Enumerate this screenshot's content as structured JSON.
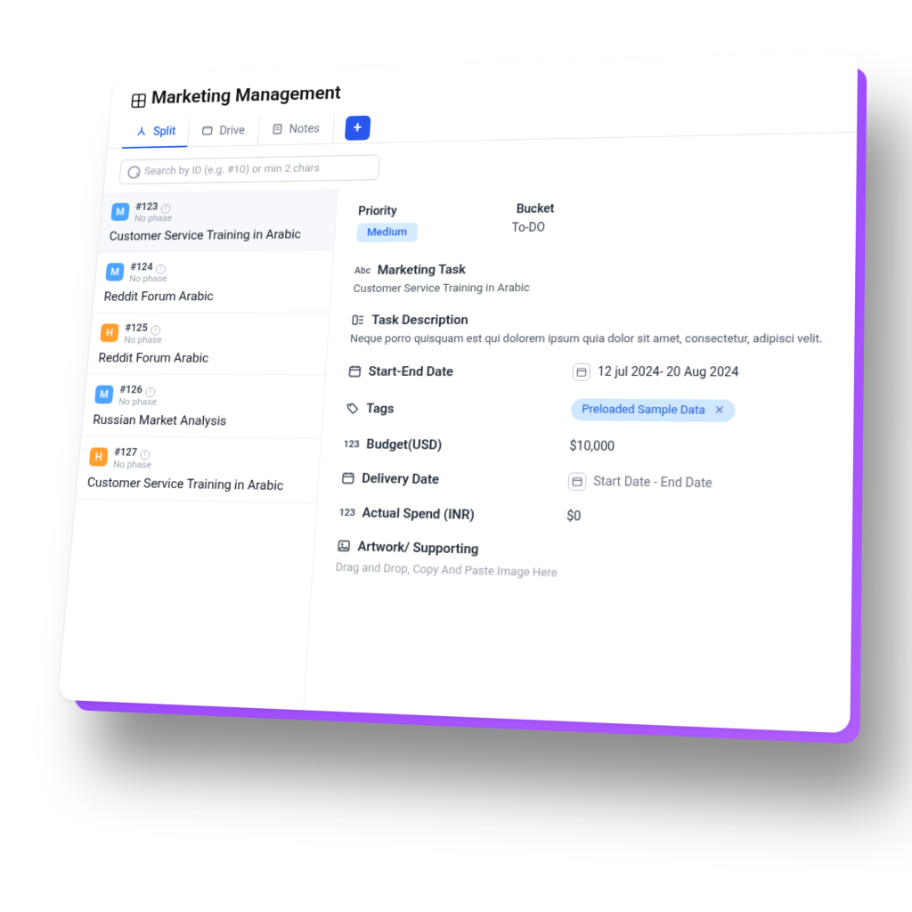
{
  "page": {
    "title": "Marketing Management"
  },
  "tabs": {
    "split": "Split",
    "drive": "Drive",
    "notes": "Notes"
  },
  "search": {
    "placeholder": "Search by ID (e.g. #10) or min 2 chars"
  },
  "items": [
    {
      "letter": "M",
      "color": "blue",
      "id": "#123",
      "phase": "No phase",
      "title": "Customer Service Training in Arabic",
      "selected": true
    },
    {
      "letter": "M",
      "color": "blue",
      "id": "#124",
      "phase": "No phase",
      "title": "Reddit Forum Arabic",
      "selected": false
    },
    {
      "letter": "H",
      "color": "orange",
      "id": "#125",
      "phase": "No phase",
      "title": "Reddit Forum Arabic",
      "selected": false
    },
    {
      "letter": "M",
      "color": "blue",
      "id": "#126",
      "phase": "No phase",
      "title": "Russian Market Analysis",
      "selected": false
    },
    {
      "letter": "H",
      "color": "orange",
      "id": "#127",
      "phase": "No phase",
      "title": "Customer Service Training in Arabic",
      "selected": false
    }
  ],
  "detail": {
    "priority_label": "Priority",
    "priority_value": "Medium",
    "bucket_label": "Bucket",
    "bucket_value": "To-DO",
    "task_label": "Marketing Task",
    "task_value": "Customer Service Training in Arabic",
    "desc_label": "Task Description",
    "desc_value": "Neque porro quisquam est qui dolorem ipsum quia dolor sit amet, consectetur, adipisci velit.",
    "date_label": "Start-End Date",
    "date_value": "12 jul 2024- 20 Aug 2024",
    "tags_label": "Tags",
    "tags_value": "Preloaded Sample Data",
    "budget_label": "Budget(USD)",
    "budget_value": "$10,000",
    "delivery_label": "Delivery Date",
    "delivery_value": "Start Date - End Date",
    "spend_label": "Actual Spend (INR)",
    "spend_value": "$0",
    "artwork_label": "Artwork/ Supporting",
    "drop_text": "Drag and Drop, Copy And Paste Image Here",
    "abc": "Abc",
    "num": "123"
  }
}
